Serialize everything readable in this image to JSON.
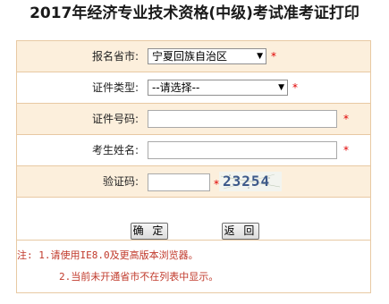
{
  "page": {
    "title": "2017年经济专业技术资格(中级)考试准考证打印"
  },
  "form": {
    "province": {
      "label": "报名省市:",
      "selected": "宁夏回族自治区"
    },
    "id_type": {
      "label": "证件类型:",
      "selected": "--请选择--"
    },
    "id_number": {
      "label": "证件号码:",
      "value": ""
    },
    "name": {
      "label": "考生姓名:",
      "value": ""
    },
    "captcha": {
      "label": "验证码:",
      "value": "",
      "image_text": "23254"
    },
    "required_mark": "*"
  },
  "buttons": {
    "confirm_label": "确 定",
    "back_label": "返 回"
  },
  "notes": {
    "line1": "注: 1.请使用IE8.0及更高版本浏览器。",
    "line2": "2.当前未开通省市不在列表中显示。"
  },
  "colors": {
    "row_shade": "#fcefdc",
    "border": "#e8c9a3",
    "required": "#e00000",
    "note_text": "#c0392b"
  }
}
